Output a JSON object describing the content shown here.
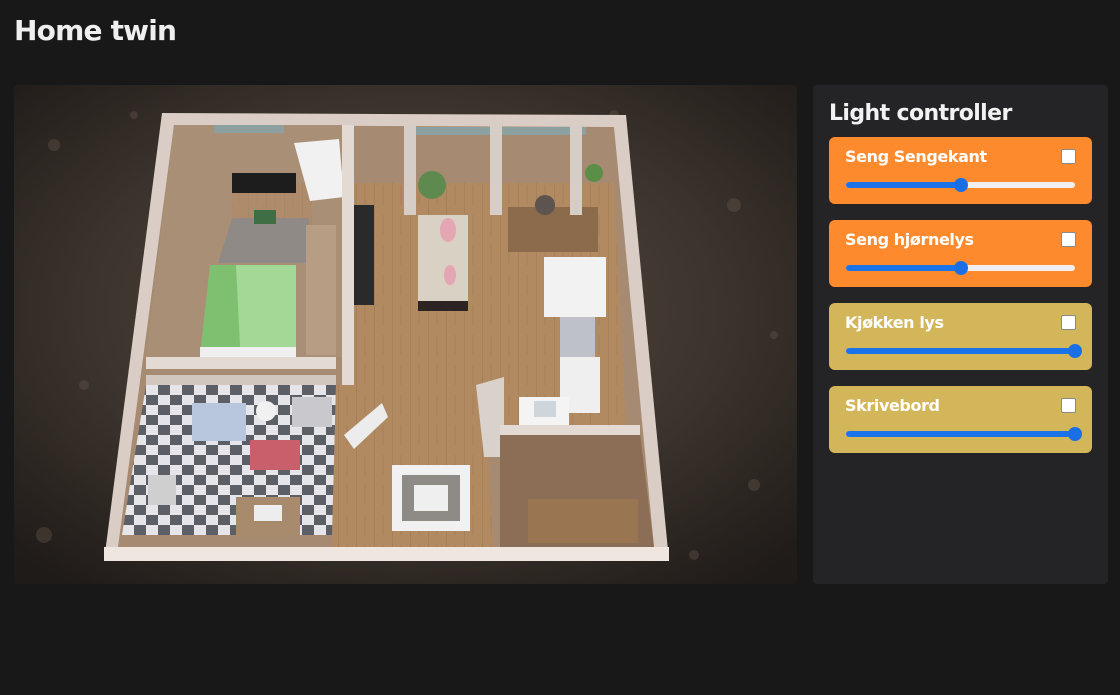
{
  "header": {
    "title": "Home twin"
  },
  "panel": {
    "title": "Light controller",
    "lights": [
      {
        "name": "Seng Sengekant",
        "on": false,
        "level_percent": 50,
        "color": "#fe8a2e"
      },
      {
        "name": "Seng hjørnelys",
        "on": false,
        "level_percent": 50,
        "color": "#fe8a2e"
      },
      {
        "name": "Kjøkken lys",
        "on": false,
        "level_percent": 100,
        "color": "#d4b65a"
      },
      {
        "name": "Skrivebord",
        "on": false,
        "level_percent": 100,
        "color": "#d4b65a"
      }
    ]
  },
  "colors": {
    "background": "#181818",
    "panel": "#242426",
    "slider_accent": "#1a73e8"
  }
}
